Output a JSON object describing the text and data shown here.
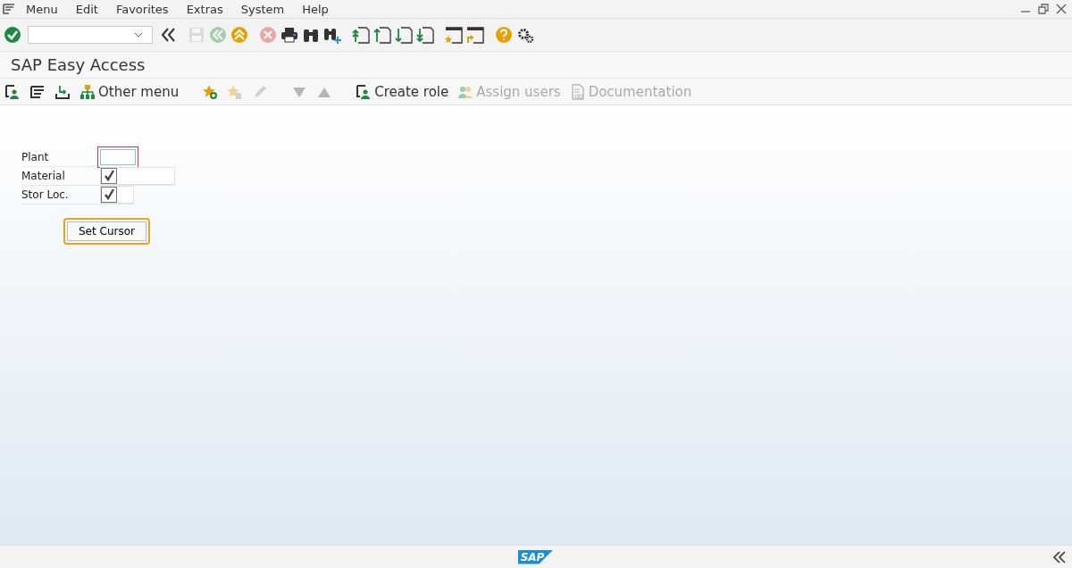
{
  "menu_bar": {
    "items": [
      "Menu",
      "Edit",
      "Favorites",
      "Extras",
      "System",
      "Help"
    ]
  },
  "system_toolbar": {
    "buttons": [
      {
        "disabled": false
      },
      {
        "disabled": false
      },
      {
        "disabled": true
      },
      {
        "disabled": true
      },
      {
        "disabled": false
      },
      {
        "disabled": true
      },
      {
        "disabled": false
      },
      {
        "disabled": false
      },
      {
        "disabled": false
      },
      {
        "disabled": false
      },
      {
        "disabled": false
      },
      {
        "disabled": false
      },
      {
        "disabled": false
      },
      {
        "disabled": false
      },
      {
        "disabled": false
      },
      {
        "disabled": false
      },
      {
        "disabled": false
      }
    ]
  },
  "title": "SAP Easy Access",
  "app_toolbar": {
    "buttons": [
      {
        "disabled": false
      },
      {
        "disabled": false
      },
      {
        "disabled": false
      },
      {
        "label": "Other menu",
        "disabled": false
      },
      {
        "disabled": false
      },
      {
        "disabled": true
      },
      {
        "disabled": true
      },
      {
        "disabled": true
      },
      {
        "disabled": true
      },
      {
        "label": "Create role",
        "disabled": false
      },
      {
        "label": "Assign users",
        "disabled": true
      },
      {
        "label": "Documentation",
        "disabled": true
      }
    ]
  },
  "form": {
    "rows": [
      {
        "label": "Plant",
        "kind": "text",
        "focused": true
      },
      {
        "label": "Material",
        "kind": "check",
        "checked": true
      },
      {
        "label": "Stor Loc.",
        "kind": "check",
        "checked": true
      }
    ],
    "button": {
      "label": "Set Cursor",
      "focused": true
    }
  },
  "status_bar": {
    "logo": "SAP"
  }
}
